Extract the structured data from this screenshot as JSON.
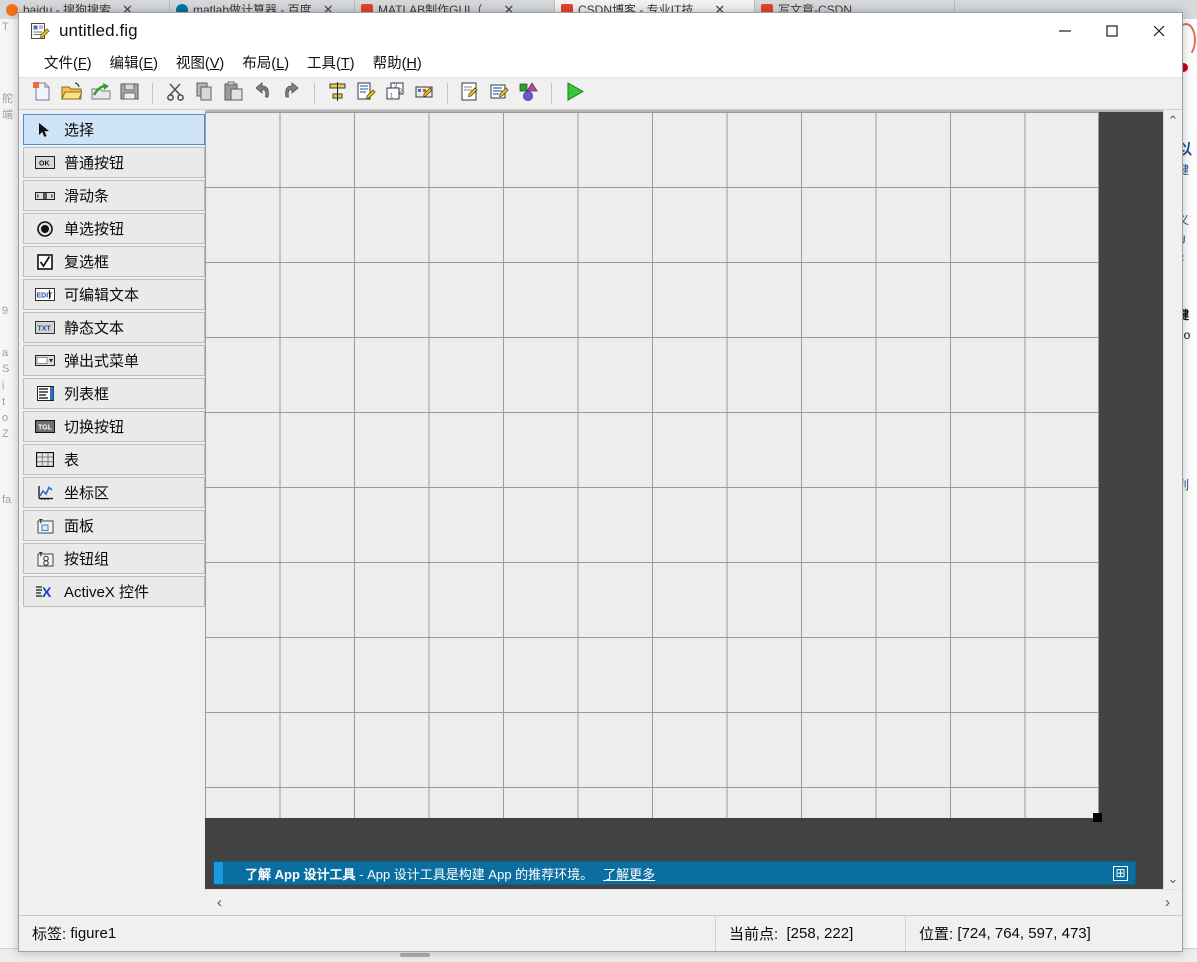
{
  "background": {
    "tabs": [
      {
        "favicon": "sogou-icon",
        "label": "baidu - 搜狗搜索",
        "close": "✕"
      },
      {
        "favicon": "matlab-icon",
        "label": "matlab做计算器 - 百度",
        "close": "✕"
      },
      {
        "favicon": "csdn-icon",
        "label": "MATLAB制作GUI（...",
        "close": "✕"
      },
      {
        "favicon": "csdn-icon",
        "label": "CSDN博客 - 专业IT技...",
        "close": "✕"
      },
      {
        "favicon": "csdn-icon",
        "label": "写文章-CSDN",
        "close": ""
      }
    ],
    "left_column_lines": [
      "T",
      "舵",
      "端",
      "9",
      "a",
      "S",
      "i",
      "t",
      "o",
      "Z",
      "fa"
    ],
    "right_column_lines": [
      "以",
      "键",
      "义",
      "U",
      "F",
      "键",
      "do",
      "列"
    ]
  },
  "window": {
    "title": "untitled.fig",
    "icon": "figure-file-icon",
    "controls": {
      "minimize": {
        "name": "minimize-button",
        "glyph": "—"
      },
      "maximize": {
        "name": "maximize-button",
        "glyph": "☐"
      },
      "close": {
        "name": "close-button",
        "glyph": "✕"
      }
    }
  },
  "menubar": [
    {
      "text": "文件",
      "mnemonic": "F"
    },
    {
      "text": "编辑",
      "mnemonic": "E"
    },
    {
      "text": "视图",
      "mnemonic": "V"
    },
    {
      "text": "布局",
      "mnemonic": "L"
    },
    {
      "text": "工具",
      "mnemonic": "T"
    },
    {
      "text": "帮助",
      "mnemonic": "H"
    }
  ],
  "toolbar": [
    {
      "name": "new-figure-button",
      "icon": "new-document-icon"
    },
    {
      "name": "open-figure-button",
      "icon": "open-folder-icon"
    },
    {
      "name": "export-button",
      "icon": "green-arrow-folder-icon"
    },
    {
      "name": "save-button",
      "icon": "floppy-disk-icon"
    },
    {
      "name": "separator-1",
      "icon": "separator"
    },
    {
      "name": "cut-button",
      "icon": "scissors-icon"
    },
    {
      "name": "copy-button",
      "icon": "copy-icon"
    },
    {
      "name": "paste-button",
      "icon": "paste-icon"
    },
    {
      "name": "undo-button",
      "icon": "undo-arrow-icon"
    },
    {
      "name": "redo-button",
      "icon": "redo-arrow-icon"
    },
    {
      "name": "separator-2",
      "icon": "separator"
    },
    {
      "name": "align-objects-button",
      "icon": "align-objects-icon"
    },
    {
      "name": "menu-editor-button",
      "icon": "menu-editor-icon"
    },
    {
      "name": "tab-order-editor-button",
      "icon": "tab-order-icon"
    },
    {
      "name": "toolbar-editor-button",
      "icon": "toolbar-editor-icon"
    },
    {
      "name": "separator-3",
      "icon": "separator"
    },
    {
      "name": "m-file-editor-button",
      "icon": "m-file-editor-icon"
    },
    {
      "name": "property-inspector-button",
      "icon": "property-inspector-icon"
    },
    {
      "name": "object-browser-button",
      "icon": "object-browser-icon"
    },
    {
      "name": "separator-4",
      "icon": "separator"
    },
    {
      "name": "run-button",
      "icon": "run-play-icon"
    }
  ],
  "palette": [
    {
      "label": "选择",
      "icon": "cursor-arrow-icon",
      "selected": true
    },
    {
      "label": "普通按钮",
      "icon": "push-button-icon",
      "selected": false
    },
    {
      "label": "滑动条",
      "icon": "slider-icon",
      "selected": false
    },
    {
      "label": "单选按钮",
      "icon": "radio-button-icon",
      "selected": false
    },
    {
      "label": "复选框",
      "icon": "checkbox-icon",
      "selected": false
    },
    {
      "label": "可编辑文本",
      "icon": "edit-text-icon",
      "selected": false
    },
    {
      "label": "静态文本",
      "icon": "static-text-icon",
      "selected": false
    },
    {
      "label": "弹出式菜单",
      "icon": "popup-menu-icon",
      "selected": false
    },
    {
      "label": "列表框",
      "icon": "listbox-icon",
      "selected": false
    },
    {
      "label": "切换按钮",
      "icon": "toggle-button-icon",
      "selected": false
    },
    {
      "label": "表",
      "icon": "table-icon",
      "selected": false
    },
    {
      "label": "坐标区",
      "icon": "axes-icon",
      "selected": false
    },
    {
      "label": "面板",
      "icon": "panel-icon",
      "selected": false
    },
    {
      "label": "按钮组",
      "icon": "button-group-icon",
      "selected": false
    },
    {
      "label": "ActiveX 控件",
      "icon": "activex-icon",
      "selected": false
    }
  ],
  "banner": {
    "strong": "了解 App 设计工具",
    "dash": " - ",
    "text": "App 设计工具是构建 App 的推荐环境。",
    "link": "了解更多",
    "expand_glyph": "⊞",
    "accent_color": "#1899e0",
    "background_color": "#0b6ea0"
  },
  "scroll": {
    "up_arrow": "⌃",
    "down_arrow": "⌄",
    "left_arrow": "‹",
    "right_arrow": "›"
  },
  "statusbar": {
    "tag_label": "标签:",
    "tag_value": "figure1",
    "current_point_label": "当前点:",
    "current_point_value": "[258, 222]",
    "position_label": "位置:",
    "position_value": "[724, 764, 597, 473]"
  }
}
